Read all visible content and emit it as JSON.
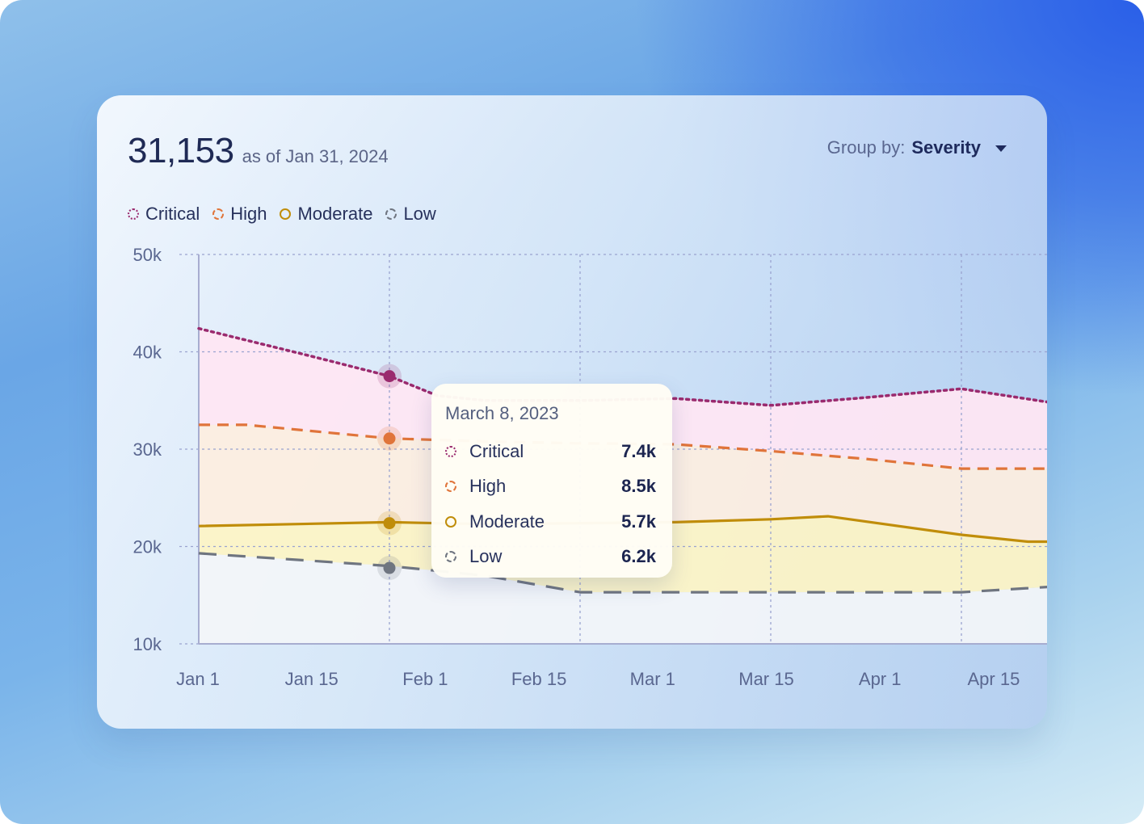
{
  "summary": {
    "total": "31,153",
    "as_of": "as of Jan 31, 2024"
  },
  "group_by": {
    "label": "Group by:",
    "value": "Severity"
  },
  "colors": {
    "critical": "#9a2a6e",
    "high": "#e0743a",
    "moderate": "#c08d0a",
    "low": "#6f7580",
    "critical_fill": "#ffe6f3",
    "high_fill": "#fdeee0",
    "moderate_fill": "#fdf4c4",
    "low_fill": "#f3f5f8",
    "axis_text": "#5a6790",
    "grid": "#9aa3d0"
  },
  "tooltip": {
    "date": "March 8, 2023",
    "rows": [
      {
        "name": "Critical",
        "value": "7.4k",
        "series": "critical"
      },
      {
        "name": "High",
        "value": "8.5k",
        "series": "high"
      },
      {
        "name": "Moderate",
        "value": "5.7k",
        "series": "moderate"
      },
      {
        "name": "Low",
        "value": "6.2k",
        "series": "low"
      }
    ]
  },
  "chart_data": {
    "type": "area",
    "title": "",
    "xlabel": "",
    "ylabel": "",
    "x_ticks": [
      "Jan 1",
      "Jan 15",
      "Feb 1",
      "Feb 15",
      "Mar 1",
      "Mar 15",
      "Apr 1",
      "Apr 15"
    ],
    "y_ticks": [
      "10k",
      "20k",
      "30k",
      "40k",
      "50k"
    ],
    "ylim": [
      10000,
      50000
    ],
    "xlim": [
      0,
      4.5
    ],
    "grid": true,
    "legend_position": "top-left",
    "series": [
      {
        "name": "Critical",
        "key": "critical",
        "style": "dotted",
        "x": [
          0,
          0.6,
          1,
          1.25,
          1.5,
          2,
          2.5,
          3,
          3.5,
          4,
          4.5
        ],
        "y": [
          42400,
          39500,
          37500,
          35500,
          35000,
          35000,
          35200,
          34500,
          35300,
          36200,
          34700
        ]
      },
      {
        "name": "High",
        "key": "high",
        "style": "dashed",
        "x": [
          0,
          0.25,
          1,
          1.5,
          2,
          2.5,
          3,
          3.5,
          4,
          4.5
        ],
        "y": [
          32500,
          32500,
          31100,
          30800,
          30600,
          30500,
          29800,
          29000,
          28000,
          28000
        ],
        "tooltip_series": "high"
      },
      {
        "name": "Moderate",
        "key": "moderate",
        "style": "solid",
        "x": [
          0,
          1,
          1.5,
          2,
          2.5,
          3,
          3.3,
          4,
          4.35,
          4.5
        ],
        "y": [
          22100,
          22500,
          22300,
          22400,
          22500,
          22800,
          23100,
          21200,
          20500,
          20500
        ]
      },
      {
        "name": "Low",
        "key": "low",
        "style": "longdash",
        "x": [
          0,
          1,
          1.5,
          2,
          3,
          3.5,
          4,
          4.5
        ],
        "y": [
          19300,
          18000,
          17000,
          15300,
          15300,
          15300,
          15300,
          15900
        ]
      }
    ],
    "hover_x": 1,
    "hover_points": {
      "critical": 37500,
      "high": 31100,
      "moderate": 22400,
      "low": 17800
    }
  }
}
